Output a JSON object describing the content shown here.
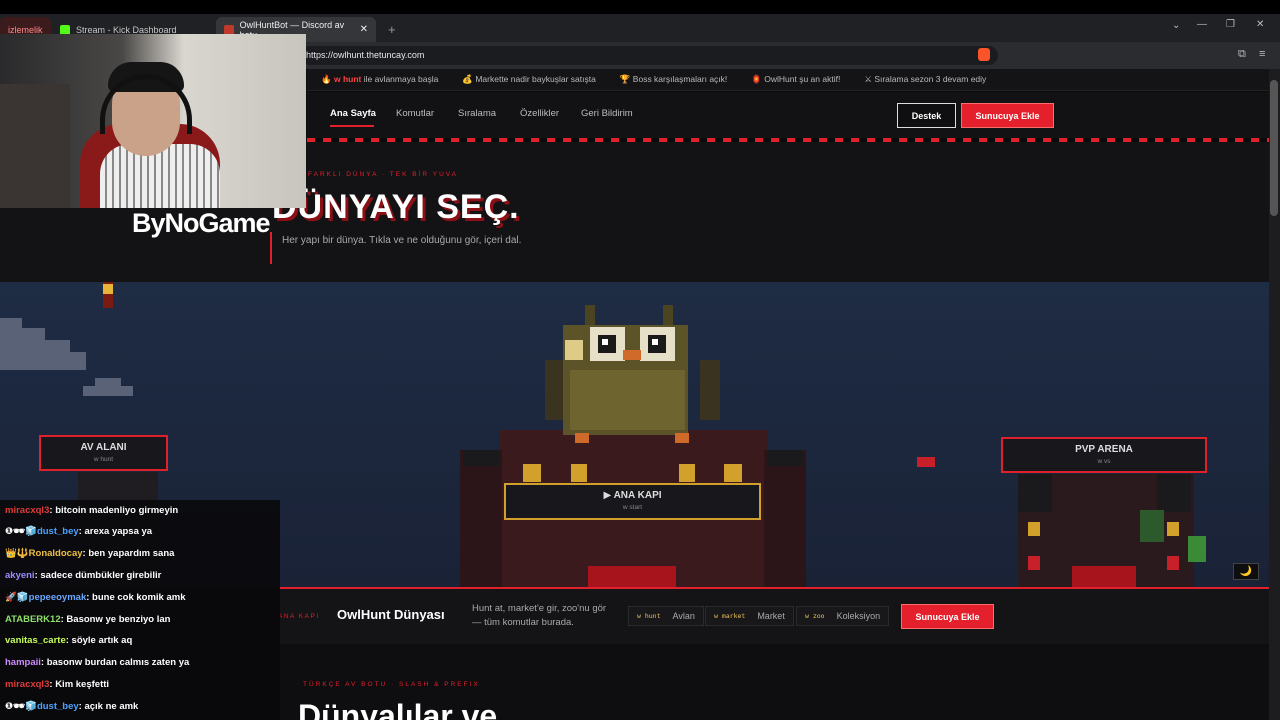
{
  "tabs": [
    {
      "label": "izlemelik"
    },
    {
      "label": "Stream - Kick Dashboard"
    },
    {
      "label": "OwlHuntBot — Discord av botu"
    }
  ],
  "url": "https://owlhunt.thetuncay.com",
  "ticker": [
    {
      "icon": "🔥",
      "cmd": "w hunt",
      "text": " ile avlanmaya başla"
    },
    {
      "icon": "💰",
      "cmd": "",
      "text": "Markette nadir baykuşlar satışta"
    },
    {
      "icon": "🏆",
      "cmd": "",
      "text": "Boss karşılaşmaları açık!"
    },
    {
      "icon": "🏮",
      "cmd": "",
      "text": "OwlHunt şu an aktif!"
    },
    {
      "icon": "⚔",
      "cmd": "",
      "text": "Sıralama sezon 3 devam ediy"
    }
  ],
  "nav": {
    "items": [
      "Ana Sayfa",
      "Komutlar",
      "Sıralama",
      "Özellikler",
      "Geri Bildirim"
    ],
    "support": "Destek",
    "add": "Sunucuya Ekle"
  },
  "hero": {
    "eyebrow": "FARKLI DÜNYA · TEK BİR YUVA",
    "title": "DÜNYAYI SEÇ.",
    "subtitle": "Her yapı bir dünya. Tıkla ve ne olduğunu gör, içeri dal."
  },
  "zones": {
    "left": {
      "title": "AV ALANI",
      "cmd": "w hunt"
    },
    "gate": {
      "title": "▶ ANA KAPI",
      "cmd": "w start"
    },
    "right": {
      "title": "PVP ARENA",
      "cmd": "w vs"
    }
  },
  "strip": {
    "eyebrow": "ANA KAPI",
    "title": "OwlHunt Dünyası",
    "desc": "Hunt at, market'e gir, zoo'nu gör — tüm komutlar burada.",
    "cmds": [
      {
        "code": "w hunt",
        "label": "Avlan"
      },
      {
        "code": "w market",
        "label": "Market"
      },
      {
        "code": "w zoo",
        "label": "Koleksiyon"
      }
    ],
    "add": "Sunucuya Ekle"
  },
  "lower": {
    "eyebrow": "TÜRKÇE AV BOTU · SLASH & PREFIX",
    "title": "Dünyalılar ve"
  },
  "overlay": {
    "brand": "ByNoGame"
  },
  "chat": [
    {
      "user": "miracxql3",
      "color": "#e03a3a",
      "badges": "",
      "text": "bitcoin madenliyo girmeyin"
    },
    {
      "user": "dust_bey",
      "color": "#4aa3ff",
      "badges": "❶🕶🧊",
      "text": "arexa yapsa ya"
    },
    {
      "user": "Ronaldocay",
      "color": "#f0c040",
      "badges": "👑🔱",
      "text": "ben yapardım sana"
    },
    {
      "user": "akyeni",
      "color": "#9a8cff",
      "badges": "",
      "text": "sadece dümbükler girebilir"
    },
    {
      "user": "pepeeoymak",
      "color": "#6aa8ff",
      "badges": "🚀🧊",
      "text": "bune cok komik amk"
    },
    {
      "user": "ATABERK12",
      "color": "#8ee06a",
      "badges": "",
      "text": "Basonw ye benziyo lan"
    },
    {
      "user": "vanitas_carte",
      "color": "#c6ff5a",
      "badges": "",
      "text": "söyle artık aq"
    },
    {
      "user": "hampaii",
      "color": "#d08cff",
      "badges": "",
      "text": "basonw burdan calmıs zaten ya"
    },
    {
      "user": "miracxql3",
      "color": "#e03a3a",
      "badges": "",
      "text": "Kim keşfetti"
    },
    {
      "user": "dust_bey",
      "color": "#4aa3ff",
      "badges": "❶🕶🧊",
      "text": "açık ne amk"
    }
  ],
  "colors": {
    "accent": "#e0202a",
    "gold": "#d2a12b"
  }
}
